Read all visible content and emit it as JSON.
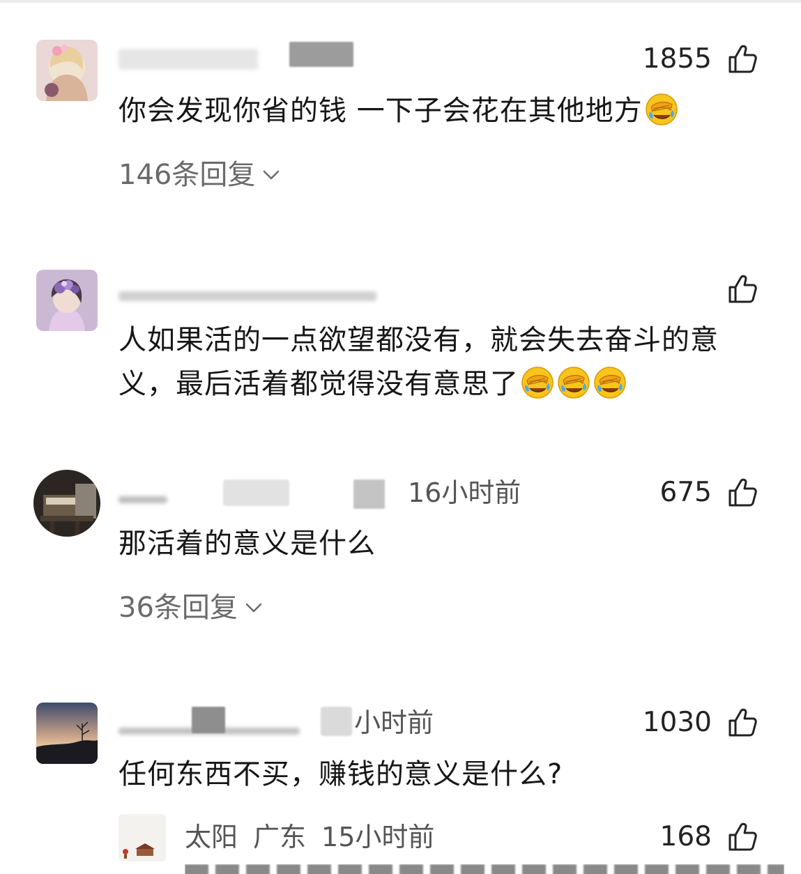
{
  "comments": [
    {
      "likes": "1855",
      "text": "你会发现你省的钱 一下子会花在其他地方",
      "emoji_count": 1,
      "replies": "146条回复"
    },
    {
      "likes": "",
      "text_line1": "人如果活的一点欲望都没有，就会失去奋斗的意",
      "text_line2": "义，最后活着都觉得没有意思了",
      "emoji_count": 3
    },
    {
      "time": "16小时前",
      "likes": "675",
      "text": "那活着的意义是什么",
      "replies": "36条回复"
    },
    {
      "time": "小时前",
      "likes": "1030",
      "text": "任何东西不买，赚钱的意义是什么?"
    }
  ],
  "sub_reply": {
    "name": "太阳",
    "location": "广东",
    "time": "15小时前",
    "likes": "168"
  },
  "icons": {
    "like": "thumbs-up-icon",
    "emoji": "face-palm-crying-emoji",
    "expand": "chevron-down-icon"
  },
  "colors": {
    "text": "#161616",
    "meta": "#555555",
    "reply_link": "#6a6a6a",
    "emoji": "#f7c21c"
  }
}
